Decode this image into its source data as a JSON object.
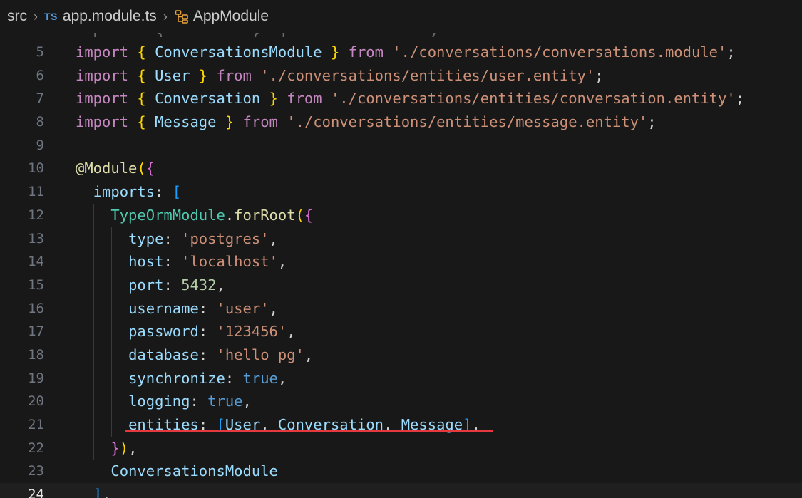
{
  "breadcrumb": {
    "folder": "src",
    "file_badge": "TS",
    "file": "app.module.ts",
    "symbol": "AppModule",
    "separator": "›"
  },
  "peek_fragment": "  i      {         }  f      '        /        '",
  "code": {
    "lines": [
      {
        "num": "5",
        "parts": [
          [
            "kw",
            "import"
          ],
          [
            "punc",
            " "
          ],
          [
            "b1",
            "{"
          ],
          [
            "punc",
            " "
          ],
          [
            "id",
            "ConversationsModule"
          ],
          [
            "punc",
            " "
          ],
          [
            "b1",
            "}"
          ],
          [
            "punc",
            " "
          ],
          [
            "kw",
            "from"
          ],
          [
            "punc",
            " "
          ],
          [
            "str",
            "'./conversations/conversations.module'"
          ],
          [
            "punc",
            ";"
          ]
        ]
      },
      {
        "num": "6",
        "parts": [
          [
            "kw",
            "import"
          ],
          [
            "punc",
            " "
          ],
          [
            "b1",
            "{"
          ],
          [
            "punc",
            " "
          ],
          [
            "id",
            "User"
          ],
          [
            "punc",
            " "
          ],
          [
            "b1",
            "}"
          ],
          [
            "punc",
            " "
          ],
          [
            "kw",
            "from"
          ],
          [
            "punc",
            " "
          ],
          [
            "str",
            "'./conversations/entities/user.entity'"
          ],
          [
            "punc",
            ";"
          ]
        ]
      },
      {
        "num": "7",
        "parts": [
          [
            "kw",
            "import"
          ],
          [
            "punc",
            " "
          ],
          [
            "b1",
            "{"
          ],
          [
            "punc",
            " "
          ],
          [
            "id",
            "Conversation"
          ],
          [
            "punc",
            " "
          ],
          [
            "b1",
            "}"
          ],
          [
            "punc",
            " "
          ],
          [
            "kw",
            "from"
          ],
          [
            "punc",
            " "
          ],
          [
            "str",
            "'./conversations/entities/conversation.entity'"
          ],
          [
            "punc",
            ";"
          ]
        ]
      },
      {
        "num": "8",
        "parts": [
          [
            "kw",
            "import"
          ],
          [
            "punc",
            " "
          ],
          [
            "b1",
            "{"
          ],
          [
            "punc",
            " "
          ],
          [
            "id",
            "Message"
          ],
          [
            "punc",
            " "
          ],
          [
            "b1",
            "}"
          ],
          [
            "punc",
            " "
          ],
          [
            "kw",
            "from"
          ],
          [
            "punc",
            " "
          ],
          [
            "str",
            "'./conversations/entities/message.entity'"
          ],
          [
            "punc",
            ";"
          ]
        ]
      },
      {
        "num": "9",
        "parts": []
      },
      {
        "num": "10",
        "parts": [
          [
            "fn",
            "@Module"
          ],
          [
            "b1",
            "("
          ],
          [
            "b2",
            "{"
          ]
        ]
      },
      {
        "num": "11",
        "parts": [
          [
            "punc",
            "  "
          ],
          [
            "id",
            "imports"
          ],
          [
            "punc",
            ": "
          ],
          [
            "b3",
            "["
          ]
        ]
      },
      {
        "num": "12",
        "parts": [
          [
            "punc",
            "    "
          ],
          [
            "cls",
            "TypeOrmModule"
          ],
          [
            "punc",
            "."
          ],
          [
            "fn",
            "forRoot"
          ],
          [
            "b1",
            "("
          ],
          [
            "b2",
            "{"
          ]
        ]
      },
      {
        "num": "13",
        "parts": [
          [
            "punc",
            "      "
          ],
          [
            "id",
            "type"
          ],
          [
            "punc",
            ": "
          ],
          [
            "str",
            "'postgres'"
          ],
          [
            "punc",
            ","
          ]
        ]
      },
      {
        "num": "14",
        "parts": [
          [
            "punc",
            "      "
          ],
          [
            "id",
            "host"
          ],
          [
            "punc",
            ": "
          ],
          [
            "str",
            "'localhost'"
          ],
          [
            "punc",
            ","
          ]
        ]
      },
      {
        "num": "15",
        "parts": [
          [
            "punc",
            "      "
          ],
          [
            "id",
            "port"
          ],
          [
            "punc",
            ": "
          ],
          [
            "num",
            "5432"
          ],
          [
            "punc",
            ","
          ]
        ]
      },
      {
        "num": "16",
        "parts": [
          [
            "punc",
            "      "
          ],
          [
            "id",
            "username"
          ],
          [
            "punc",
            ": "
          ],
          [
            "str",
            "'user'"
          ],
          [
            "punc",
            ","
          ]
        ]
      },
      {
        "num": "17",
        "parts": [
          [
            "punc",
            "      "
          ],
          [
            "id",
            "password"
          ],
          [
            "punc",
            ": "
          ],
          [
            "str",
            "'123456'"
          ],
          [
            "punc",
            ","
          ]
        ]
      },
      {
        "num": "18",
        "parts": [
          [
            "punc",
            "      "
          ],
          [
            "id",
            "database"
          ],
          [
            "punc",
            ": "
          ],
          [
            "str",
            "'hello_pg'"
          ],
          [
            "punc",
            ","
          ]
        ]
      },
      {
        "num": "19",
        "parts": [
          [
            "punc",
            "      "
          ],
          [
            "id",
            "synchronize"
          ],
          [
            "punc",
            ": "
          ],
          [
            "const",
            "true"
          ],
          [
            "punc",
            ","
          ]
        ]
      },
      {
        "num": "20",
        "parts": [
          [
            "punc",
            "      "
          ],
          [
            "id",
            "logging"
          ],
          [
            "punc",
            ": "
          ],
          [
            "const",
            "true"
          ],
          [
            "punc",
            ","
          ]
        ]
      },
      {
        "num": "21",
        "parts": [
          [
            "punc",
            "      "
          ],
          [
            "id",
            "entities"
          ],
          [
            "punc",
            ": "
          ],
          [
            "b3",
            "["
          ],
          [
            "id",
            "User"
          ],
          [
            "punc",
            ", "
          ],
          [
            "id",
            "Conversation"
          ],
          [
            "punc",
            ", "
          ],
          [
            "id",
            "Message"
          ],
          [
            "b3",
            "]"
          ],
          [
            "punc",
            ","
          ]
        ]
      },
      {
        "num": "22",
        "parts": [
          [
            "punc",
            "    "
          ],
          [
            "b2",
            "}"
          ],
          [
            "b1",
            ")"
          ],
          [
            "punc",
            ","
          ]
        ]
      },
      {
        "num": "23",
        "parts": [
          [
            "punc",
            "    "
          ],
          [
            "id",
            "ConversationsModule"
          ]
        ]
      },
      {
        "num": "24",
        "parts": [
          [
            "punc",
            "  "
          ],
          [
            "b3",
            "]"
          ],
          [
            "punc",
            ","
          ]
        ],
        "current": true
      }
    ]
  },
  "colors": {
    "background": "#181818",
    "keyword": "#c586c0",
    "string": "#ce9178",
    "identifier": "#9cdcfe",
    "annotation_underline": "#e5383f"
  }
}
